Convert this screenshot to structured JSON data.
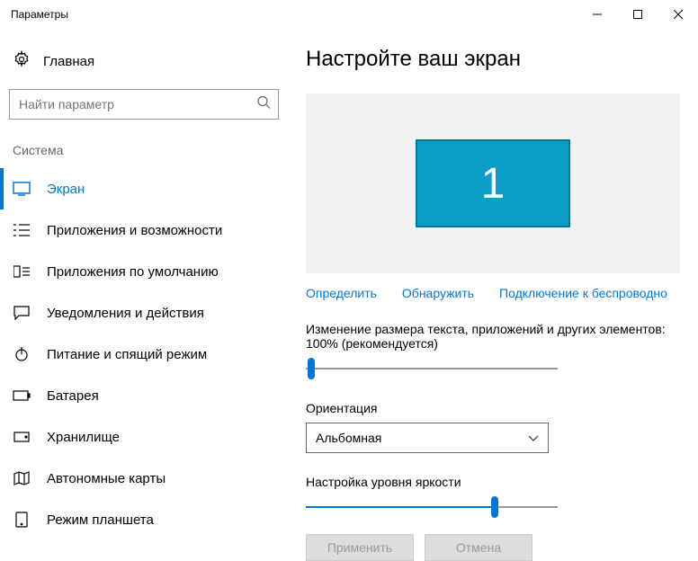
{
  "window": {
    "title": "Параметры"
  },
  "sidebar": {
    "home": "Главная",
    "searchPlaceholder": "Найти параметр",
    "category": "Система",
    "items": [
      {
        "label": "Экран"
      },
      {
        "label": "Приложения и возможности"
      },
      {
        "label": "Приложения по умолчанию"
      },
      {
        "label": "Уведомления и действия"
      },
      {
        "label": "Питание и спящий режим"
      },
      {
        "label": "Батарея"
      },
      {
        "label": "Хранилище"
      },
      {
        "label": "Автономные карты"
      },
      {
        "label": "Режим планшета"
      }
    ]
  },
  "main": {
    "heading": "Настройте ваш экран",
    "monitorNumber": "1",
    "links": {
      "identify": "Определить",
      "detect": "Обнаружить",
      "wireless": "Подключение к беспроводно"
    },
    "scale": {
      "label": "Изменение размера текста, приложений и других элементов: 100% (рекомендуется)",
      "percent": 0
    },
    "orientation": {
      "label": "Ориентация",
      "value": "Альбомная"
    },
    "brightness": {
      "label": "Настройка уровня яркости",
      "percent": 75
    },
    "buttons": {
      "apply": "Применить",
      "cancel": "Отмена"
    }
  }
}
